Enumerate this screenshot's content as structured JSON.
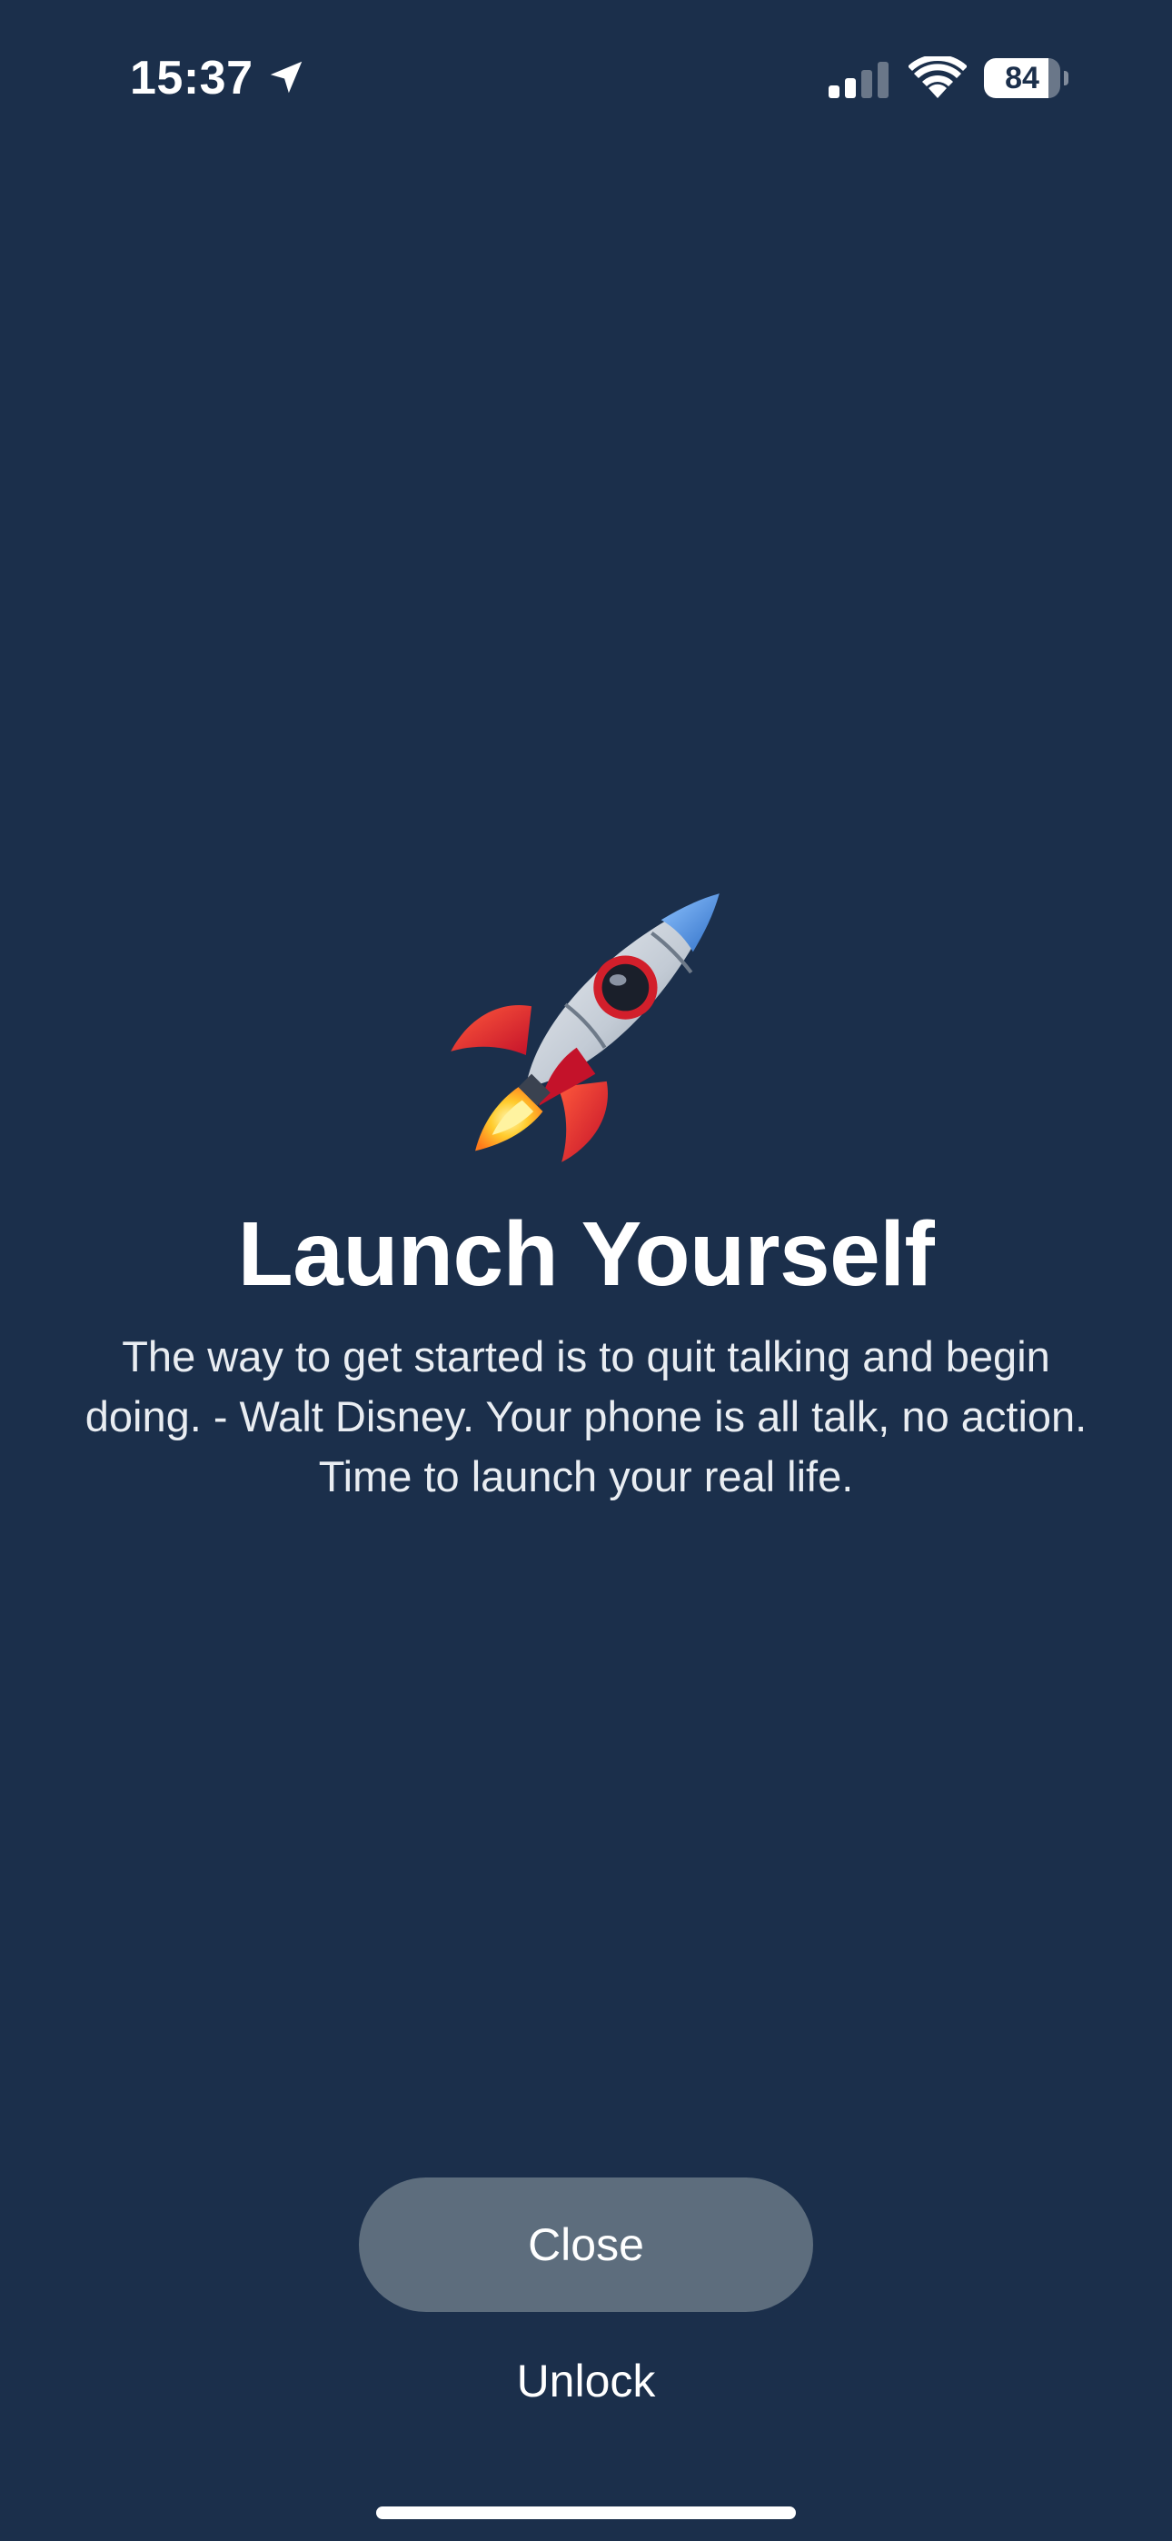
{
  "status_bar": {
    "time": "15:37",
    "location_icon": "location-arrow-icon",
    "signal_icon": "cellular-signal-icon",
    "wifi_icon": "wifi-icon",
    "battery_level": "84",
    "battery_fraction": 0.84
  },
  "hero": {
    "icon": "rocket-icon",
    "title": "Launch Yourself",
    "quote": "The way to get started is to quit talking and begin doing. - Walt Disney. Your phone is all talk, no action. Time to launch your real life."
  },
  "actions": {
    "close_label": "Close",
    "unlock_label": "Unlock"
  },
  "colors": {
    "background": "#1b2f4b",
    "close_button": "#5d6d7d",
    "text": "#ffffff"
  }
}
